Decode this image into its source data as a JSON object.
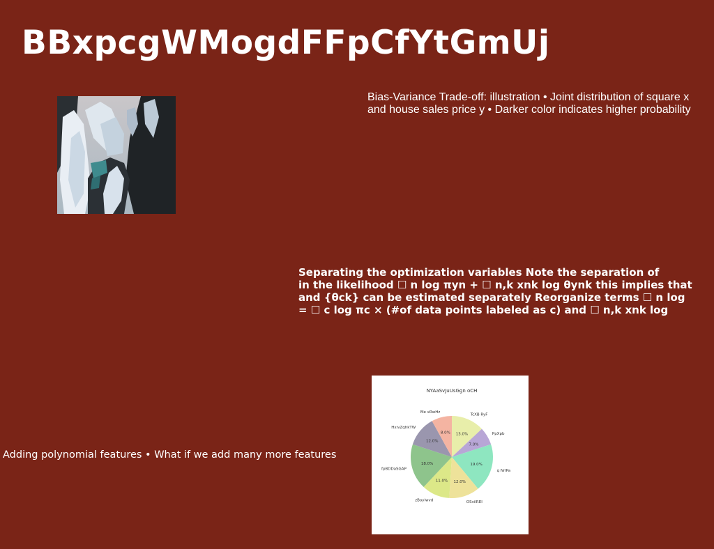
{
  "slide": {
    "title": "BBxpcgWMogdFFpCfYtGmUj",
    "caption_right": "Bias-Variance Trade-off: illustration • Joint distribution of square x and house sales price y • Darker color indicates higher probability",
    "bold_paragraph": {
      "lines": [
        "Separating the optimization variables Note the separation of",
        "in the likelihood ☐ n log πyn + ☐ n,k xnk log θynk this implies that",
        "and {θck} can be estimated separately Reorganize terms ☐ n log",
        "= ☐ c log πc × (#of data points labeled as c) and ☐ n,k xnk log"
      ]
    },
    "bullet_left": "Adding polynomial features • What if we add many more features"
  },
  "colors": {
    "background": "#7a2417",
    "text": "#ffffff"
  },
  "chart_data": {
    "type": "pie",
    "title": "NYAaSvJuUsGgn oCH",
    "labels": [
      "TcXB RyF",
      "PpXpb",
      "q NrlPa",
      "OSvilREI",
      "zBoyiwvd",
      "fpBDDaSGAP",
      "HxivZqhkTW",
      "Me xRwHz"
    ],
    "values": [
      13.0,
      7.0,
      19.0,
      12.0,
      11.0,
      18.0,
      12.0,
      8.0
    ],
    "value_labels": [
      "13.0%",
      "7.0%",
      "19.0%",
      "12.0%",
      "11.0%",
      "18.0%",
      "12.0%",
      "8.0%"
    ],
    "colors": [
      "#e8eeaa",
      "#b8a6d6",
      "#8ee6c0",
      "#eee29a",
      "#dce888",
      "#8ec48c",
      "#9a96ae",
      "#f4b4a2"
    ],
    "start": "top, clockwise"
  }
}
